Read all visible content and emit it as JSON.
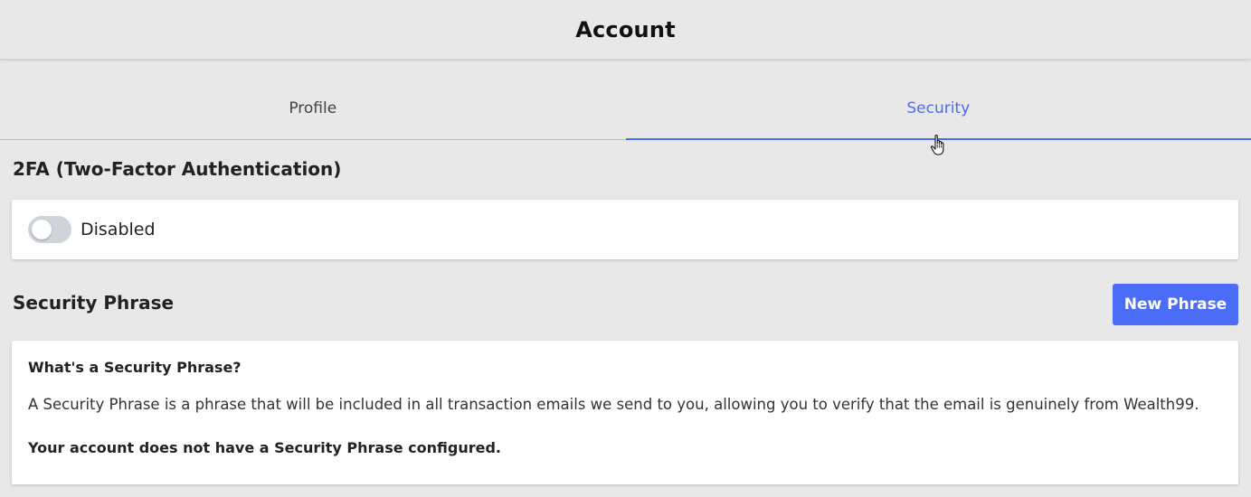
{
  "header": {
    "title": "Account"
  },
  "tabs": [
    {
      "label": "Profile",
      "active": false
    },
    {
      "label": "Security",
      "active": true
    }
  ],
  "twofa": {
    "title": "2FA (Two-Factor Authentication)",
    "toggle_state": "Disabled",
    "enabled": false
  },
  "security_phrase": {
    "title": "Security Phrase",
    "button_label": "New Phrase",
    "heading": "What's a Security Phrase?",
    "description": "A Security Phrase is a phrase that will be included in all transaction emails we send to you, allowing you to verify that the email is genuinely from Wealth99.",
    "status": "Your account does not have a Security Phrase configured."
  },
  "colors": {
    "accent": "#4a6cf7",
    "background": "#e8e8e8",
    "card": "#ffffff",
    "toggle_off": "#cfd4da"
  },
  "icons": {
    "cursor": "hand-pointer-icon"
  }
}
